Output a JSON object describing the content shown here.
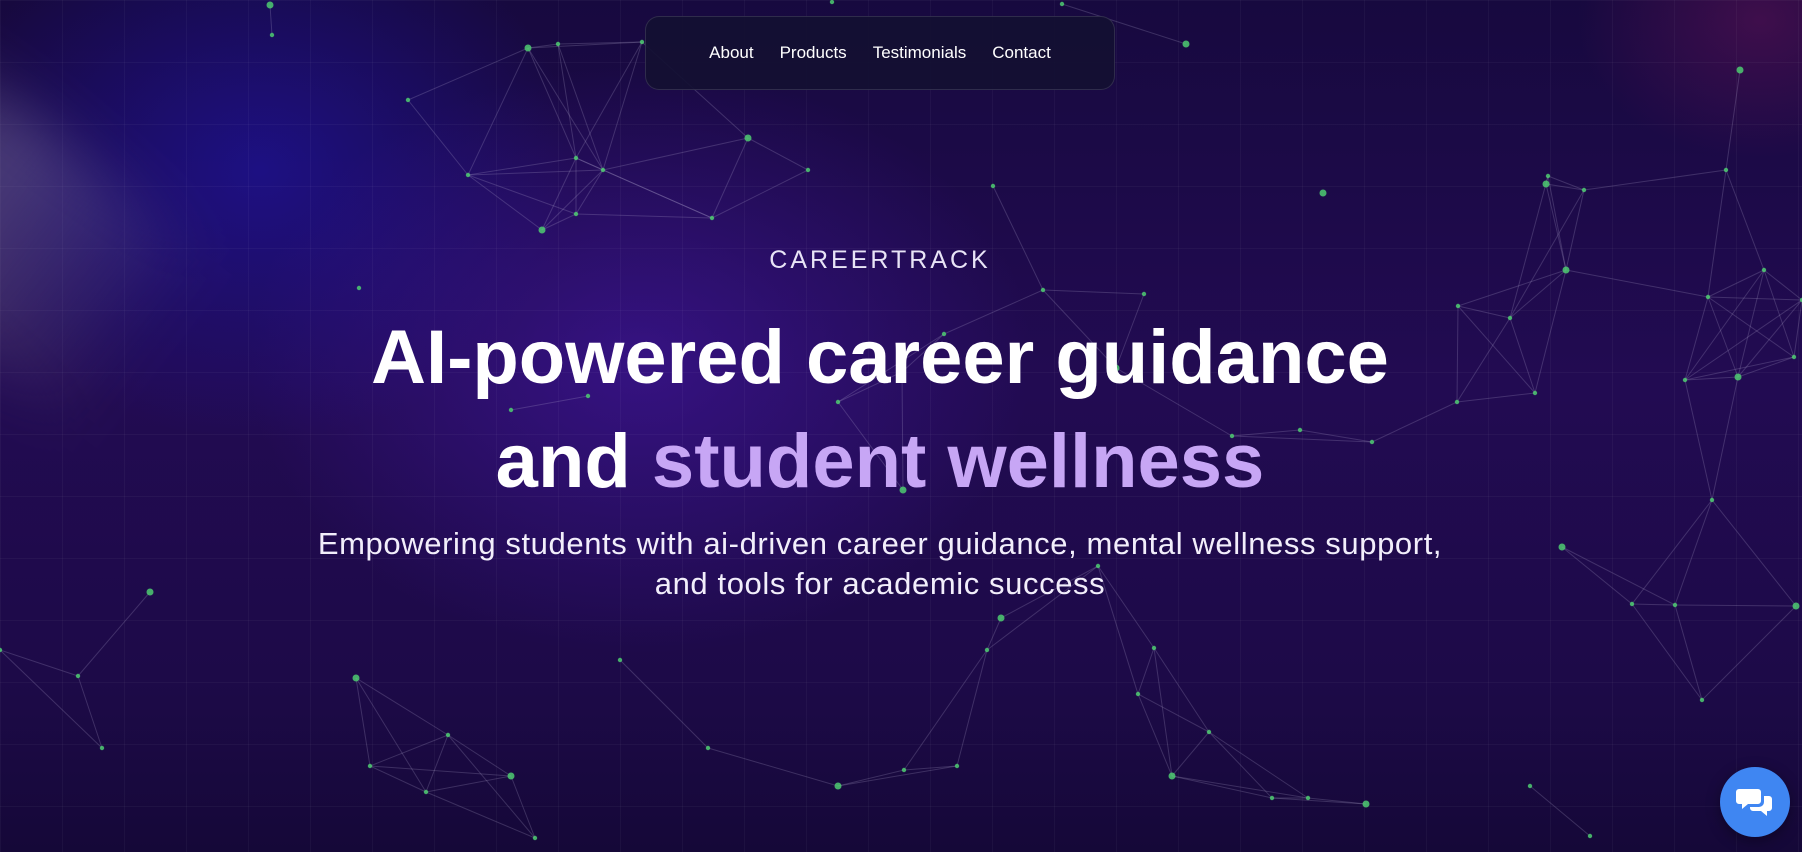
{
  "nav": {
    "items": [
      {
        "label": "About"
      },
      {
        "label": "Products"
      },
      {
        "label": "Testimonials"
      },
      {
        "label": "Contact"
      }
    ]
  },
  "hero": {
    "brand": "CAREERTRACK",
    "headline_line1": "AI-powered career guidance",
    "headline_line2_plain": "and",
    "headline_line2_accent": "student wellness",
    "subtitle": "Empowering students with ai-driven career guidance, mental wellness support, and tools for academic success"
  },
  "chat": {
    "icon": "chat-bubbles-icon"
  },
  "colors": {
    "background": "#1d0a48",
    "accent": "#c7a6f5",
    "node": "#4ecb71",
    "chat_button": "#3f86f2"
  }
}
